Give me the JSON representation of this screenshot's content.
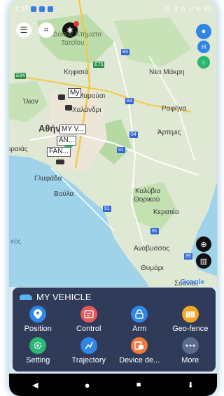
{
  "status_bar": {
    "time": "2:37",
    "signal": "⊙ .ıl ⊙ .ıl ≋",
    "battery": "94"
  },
  "map_labels": [
    {
      "text": "Δάσος Κτήματα"
    },
    {
      "text": "Τατοΐου"
    },
    {
      "text": "Κηφισιά"
    },
    {
      "text": "Νέα Μάκρη"
    },
    {
      "text": "Ίλιον"
    },
    {
      "text": "Μαρούσι"
    },
    {
      "text": "Χαλάνδρι"
    },
    {
      "text": "Ραφήνα"
    },
    {
      "text": "Αθήνα"
    },
    {
      "text": "Άρτεμις"
    },
    {
      "text": "ιραιάς"
    },
    {
      "text": "Γλυφάδα"
    },
    {
      "text": "Βούλα"
    },
    {
      "text": "Καλύβια"
    },
    {
      "text": "Θορικού"
    },
    {
      "text": "Κερατέα"
    },
    {
      "text": "Ανάβυσσος"
    },
    {
      "text": "Θυμάρι"
    },
    {
      "text": "Σουνίο"
    },
    {
      "text": "κός"
    }
  ],
  "roads": [
    {
      "text": "83",
      "color": "blue"
    },
    {
      "text": "E75",
      "color": "green"
    },
    {
      "text": "E94",
      "color": "green"
    },
    {
      "text": "83",
      "color": "blue"
    },
    {
      "text": "54",
      "color": "blue"
    },
    {
      "text": "91",
      "color": "blue"
    },
    {
      "text": "91",
      "color": "blue"
    },
    {
      "text": "91",
      "color": "blue"
    },
    {
      "text": "89",
      "color": "blue"
    }
  ],
  "vehicle_labels": [
    "My",
    "MY V...",
    "AN...",
    "FAN..."
  ],
  "google_logo": "Google",
  "panel": {
    "title": "MY VEHICLE",
    "items": [
      {
        "label": "Position",
        "icon": "location-pin-icon",
        "color": "#2f86e6"
      },
      {
        "label": "Control",
        "icon": "remote-control-icon",
        "color": "#e8585a"
      },
      {
        "label": "Arm",
        "icon": "lock-icon",
        "color": "#2f86e6"
      },
      {
        "label": "Geo-fence",
        "icon": "fence-icon",
        "color": "#f5a623"
      },
      {
        "label": "Setting",
        "icon": "gear-icon",
        "color": "#2bb673"
      },
      {
        "label": "Trajectory",
        "icon": "trajectory-icon",
        "color": "#2f86e6"
      },
      {
        "label": "Device de...",
        "icon": "device-icon",
        "color": "#f07b3f"
      },
      {
        "label": "More",
        "icon": "more-dots-icon",
        "color": "#5a6b8c"
      }
    ]
  },
  "colors": {
    "panel_bg": "#2f3b58",
    "accent_blue": "#2f86e6"
  }
}
